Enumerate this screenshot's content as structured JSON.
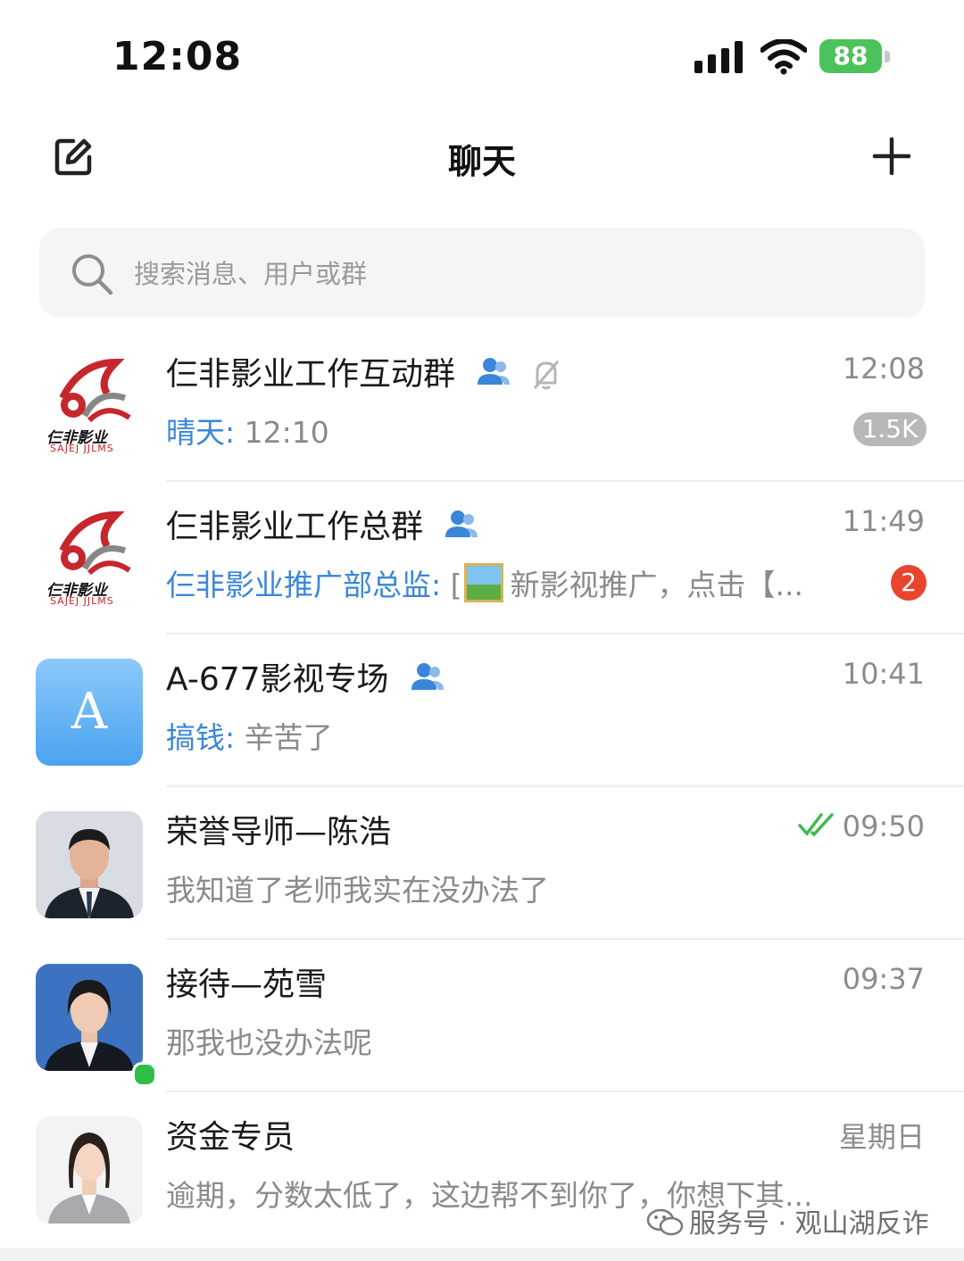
{
  "status_bar": {
    "time": "12:08",
    "battery": "88"
  },
  "header": {
    "title": "聊天"
  },
  "search": {
    "placeholder": "搜索消息、用户或群"
  },
  "chats": [
    {
      "name": "仨非影业工作互动群",
      "time": "12:08",
      "sender": "晴天:",
      "message": " 12:10",
      "badge": "1.5K",
      "group": true,
      "muted": true,
      "avatar_text": "仨非影业",
      "avatar_subtext": "SAJEJ JJLMS"
    },
    {
      "name": "仨非影业工作总群",
      "time": "11:49",
      "sender": "仨非影业推广部总监:",
      "message_prefix": " [",
      "message": "新影视推广，点击【...",
      "badge": "2",
      "group": true,
      "avatar_text": "仨非影业",
      "avatar_subtext": "SAJEJ JJLMS"
    },
    {
      "name": "A-677影视专场",
      "time": "10:41",
      "sender": "搞钱:",
      "message": " 辛苦了",
      "group": true,
      "avatar_letter": "A"
    },
    {
      "name": "荣誉导师—陈浩",
      "time": "09:50",
      "message": "我知道了老师我实在没办法了",
      "read_check": true
    },
    {
      "name": "接待—苑雪",
      "time": "09:37",
      "message": "那我也没办法呢",
      "online": true
    },
    {
      "name": "资金专员",
      "time": "星期日",
      "message": "逾期，分数太低了，这边帮不到你了，你想下其..."
    }
  ],
  "watermark": {
    "text": "服务号 · 观山湖反诈"
  },
  "colors": {
    "accent_blue": "#3a86d8",
    "badge_red": "#e8452f",
    "online_green": "#2fbf46",
    "battery_green": "#4cc35a"
  }
}
